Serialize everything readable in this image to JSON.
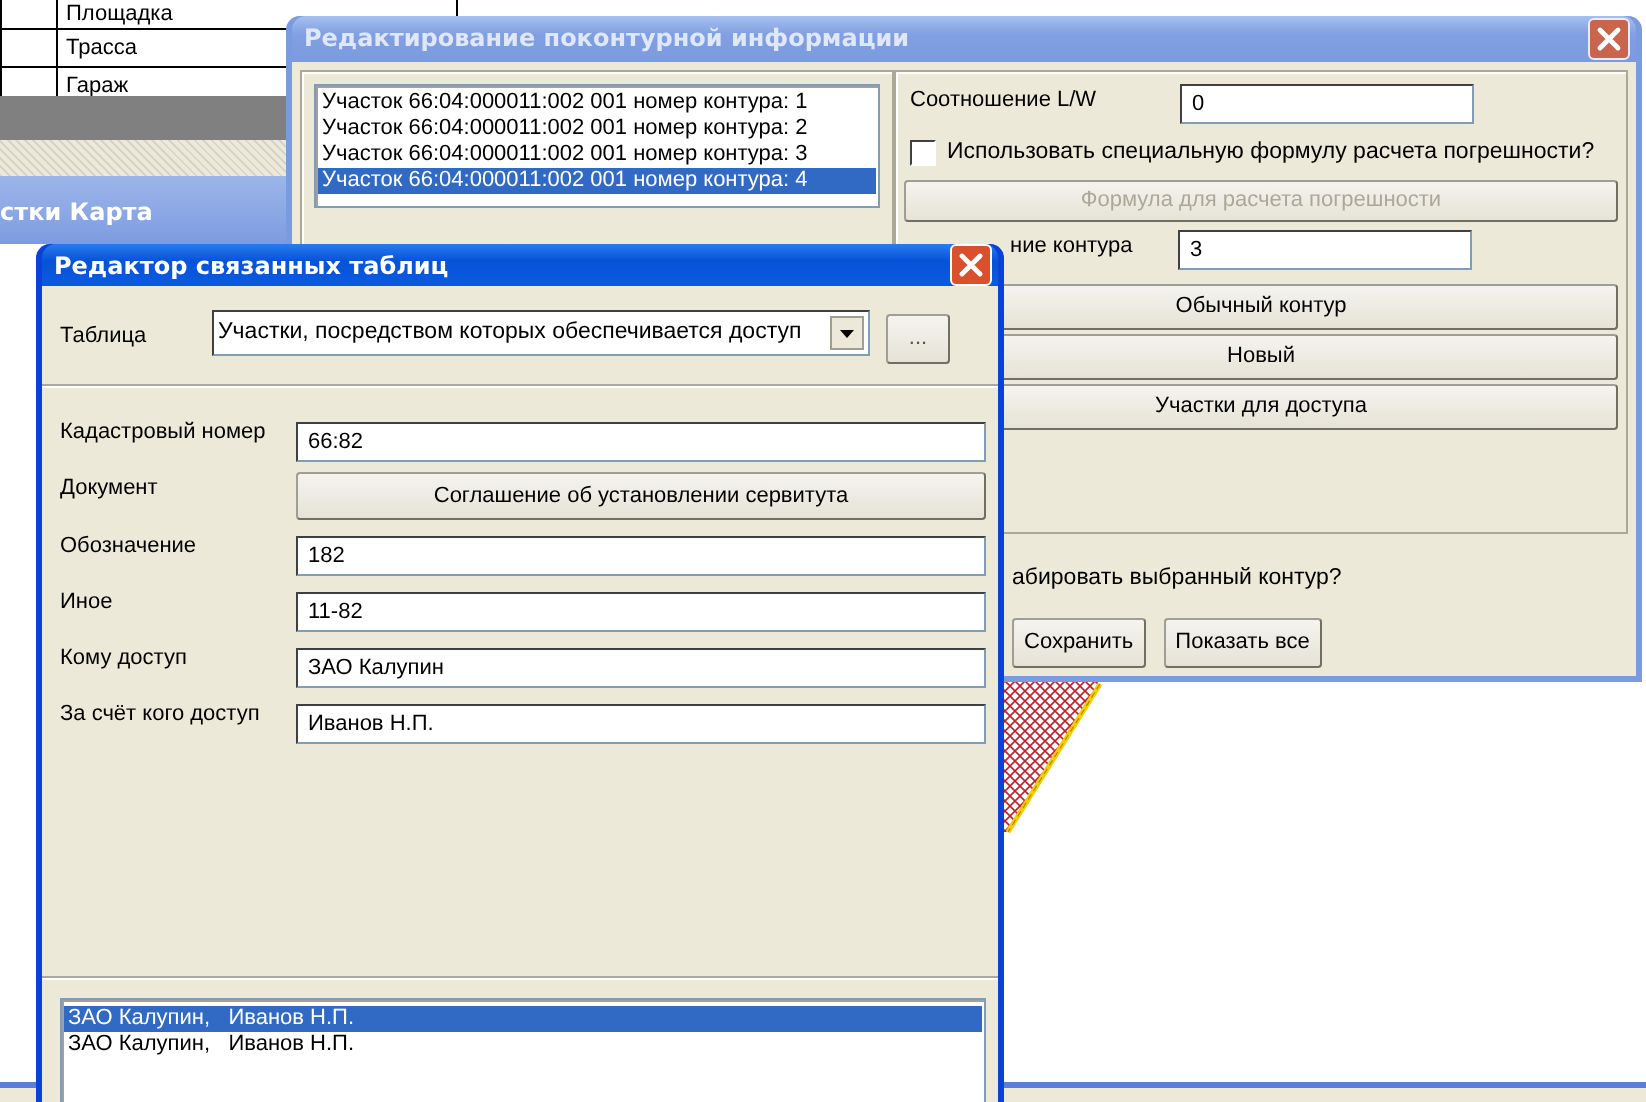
{
  "background_table": {
    "rows": [
      {
        "label": "Площадка"
      },
      {
        "label": "Трасса"
      },
      {
        "label": "Гараж"
      }
    ]
  },
  "background_window": {
    "title": "стки Карта"
  },
  "contour_dialog": {
    "title": "Редактирование поконтурной информации",
    "active": false,
    "contours": [
      {
        "label": "Участок 66:04:000011:002 001 номер контура: 1",
        "selected": false
      },
      {
        "label": "Участок 66:04:000011:002 001 номер контура: 2",
        "selected": false
      },
      {
        "label": "Участок 66:04:000011:002 001 номер контура: 3",
        "selected": false
      },
      {
        "label": "Участок 66:04:000011:002 001 номер контура: 4",
        "selected": true
      }
    ],
    "ratio": {
      "label": "Соотношение L/W",
      "value": "0"
    },
    "special_formula": {
      "label": "Использовать специальную формулу расчета погрешности?",
      "checked": false
    },
    "formula_button": {
      "label": "Формула для расчета погрешности",
      "disabled": true
    },
    "contour_field": {
      "label": "ние контура",
      "value": "3"
    },
    "buttons": [
      "Обычный контур",
      "Новый",
      "Участки для доступа"
    ],
    "question": "абировать выбранный контур?",
    "footer_buttons": [
      "Сохранить",
      "Показать все"
    ]
  },
  "table_editor": {
    "title": "Редактор связанных таблиц",
    "active": true,
    "table_label": "Таблица",
    "table_value": "Участки, посредством которых обеспечивается доступ",
    "browse_button": "...",
    "fields": [
      {
        "kind": "text",
        "label": "Кадастровый номер",
        "value": "66:82"
      },
      {
        "kind": "button",
        "label": "Документ",
        "value": "Соглашение об установлении сервитута"
      },
      {
        "kind": "text",
        "label": "Обозначение",
        "value": "182"
      },
      {
        "kind": "text",
        "label": "Иное",
        "value": "11-82"
      },
      {
        "kind": "text",
        "label": "Кому доступ",
        "value": "ЗАО Калупин"
      },
      {
        "kind": "text",
        "label": "За счёт кого доступ",
        "value": "Иванов Н.П."
      }
    ],
    "records": [
      {
        "label": "ЗАО Калупин,   Иванов Н.П.",
        "selected": true
      },
      {
        "label": "ЗАО Калупин,   Иванов Н.П.",
        "selected": false
      }
    ]
  }
}
